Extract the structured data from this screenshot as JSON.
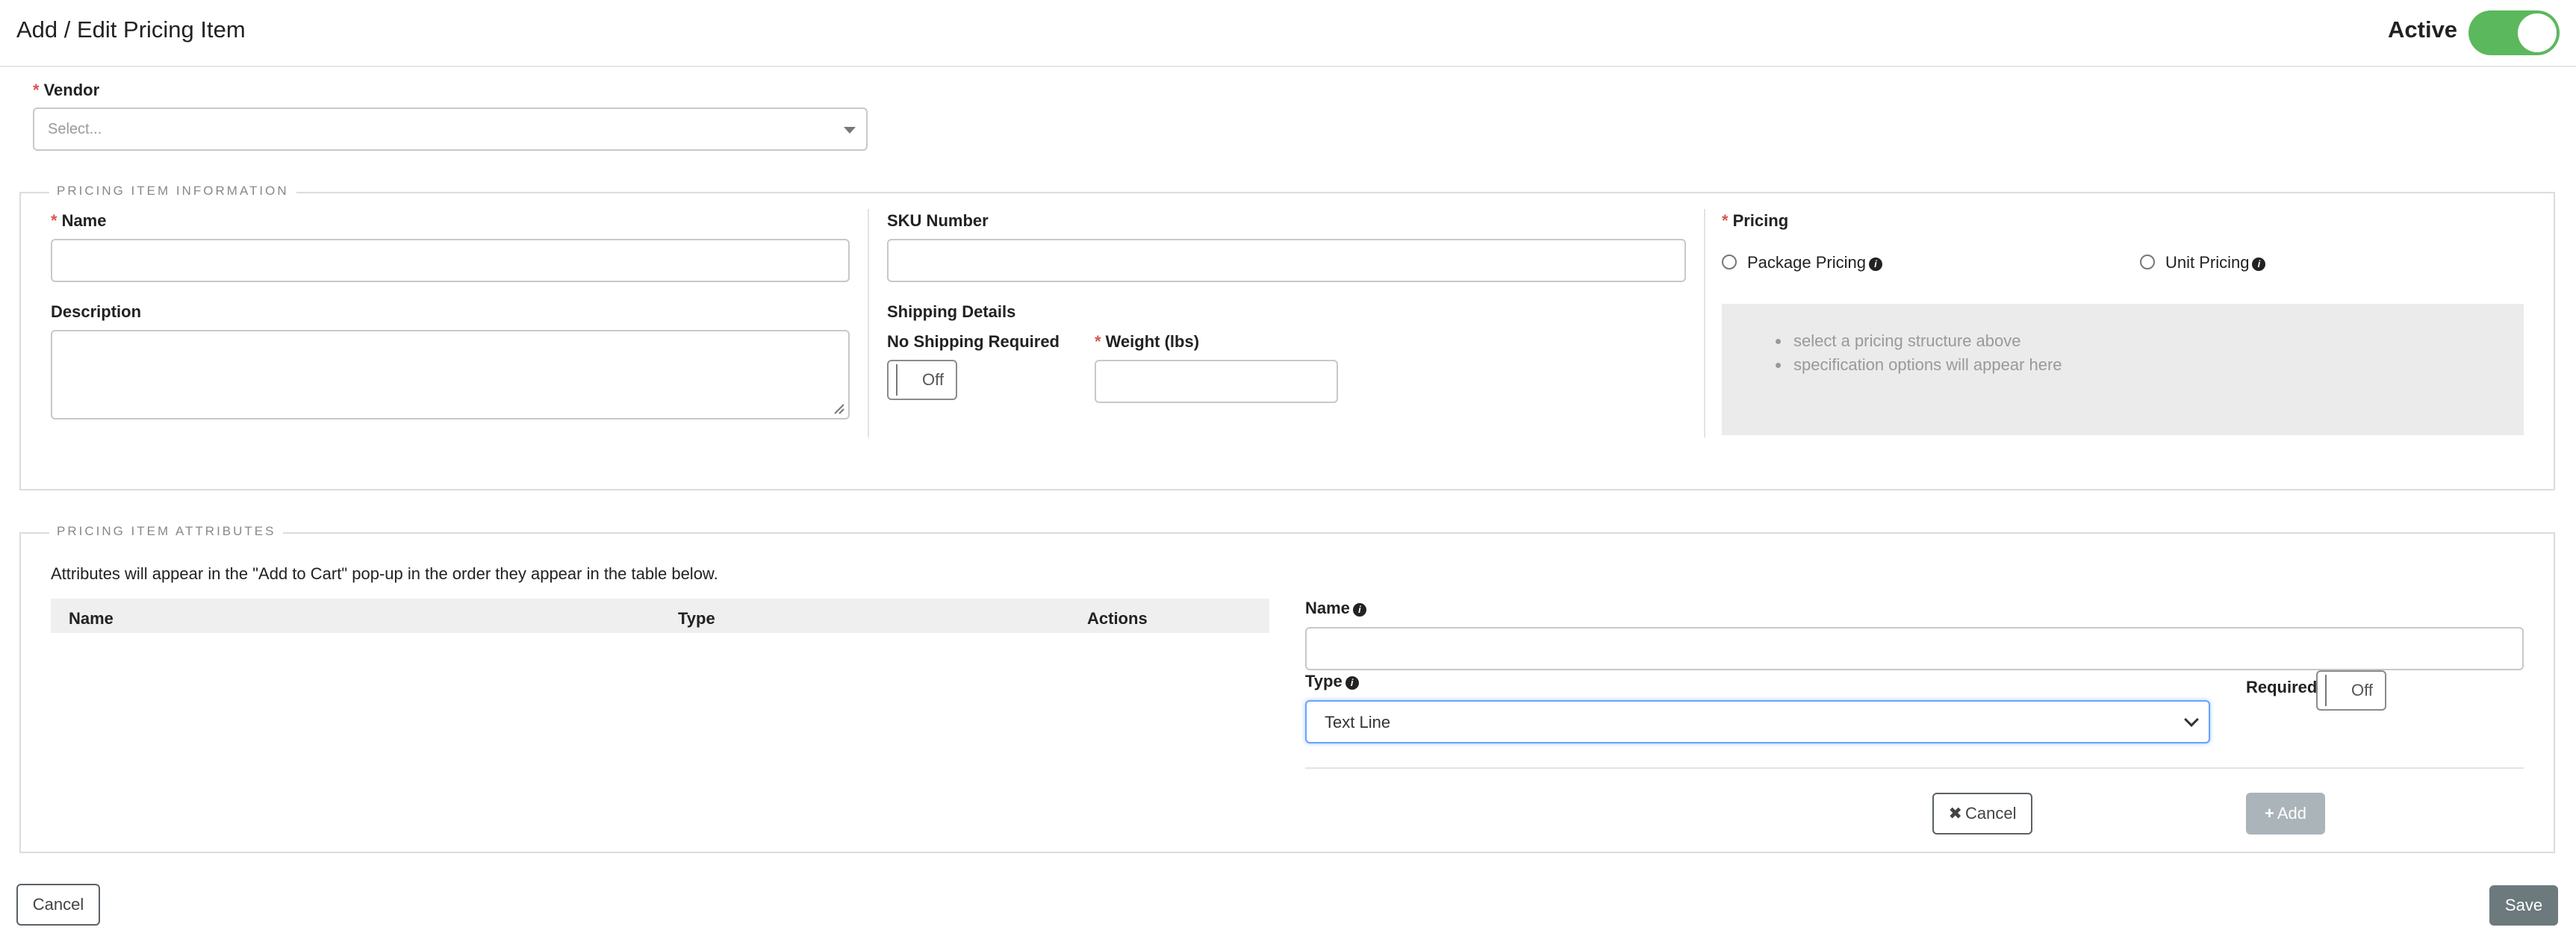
{
  "header": {
    "title": "Add / Edit Pricing Item",
    "active_label": "Active",
    "active_on": true
  },
  "vendor": {
    "label": "Vendor",
    "placeholder": "Select..."
  },
  "info_section": {
    "legend": "PRICING ITEM INFORMATION",
    "name_label": "Name",
    "description_label": "Description",
    "sku_label": "SKU Number",
    "shipping_details_label": "Shipping Details",
    "no_shipping_label": "No Shipping Required",
    "no_shipping_toggle": "Off",
    "weight_label": "Weight (lbs)",
    "pricing_label": "Pricing",
    "package_pricing_label": "Package Pricing",
    "unit_pricing_label": "Unit Pricing",
    "spec_hints": [
      "select a pricing structure above",
      "specification options will appear here"
    ]
  },
  "attributes_section": {
    "legend": "PRICING ITEM ATTRIBUTES",
    "note": "Attributes will appear in the \"Add to Cart\" pop-up in the order they appear in the table below.",
    "columns": [
      "Name",
      "Type",
      "Actions"
    ],
    "name_label": "Name",
    "type_label": "Type",
    "type_value": "Text Line",
    "required_label": "Required",
    "required_toggle": "Off",
    "cancel_label": "Cancel",
    "add_label": "Add"
  },
  "footer": {
    "cancel_label": "Cancel",
    "save_label": "Save"
  },
  "colors": {
    "accent_green": "#5cb85c",
    "required_red": "#d9534f",
    "save_gray": "#6c7a7d"
  }
}
